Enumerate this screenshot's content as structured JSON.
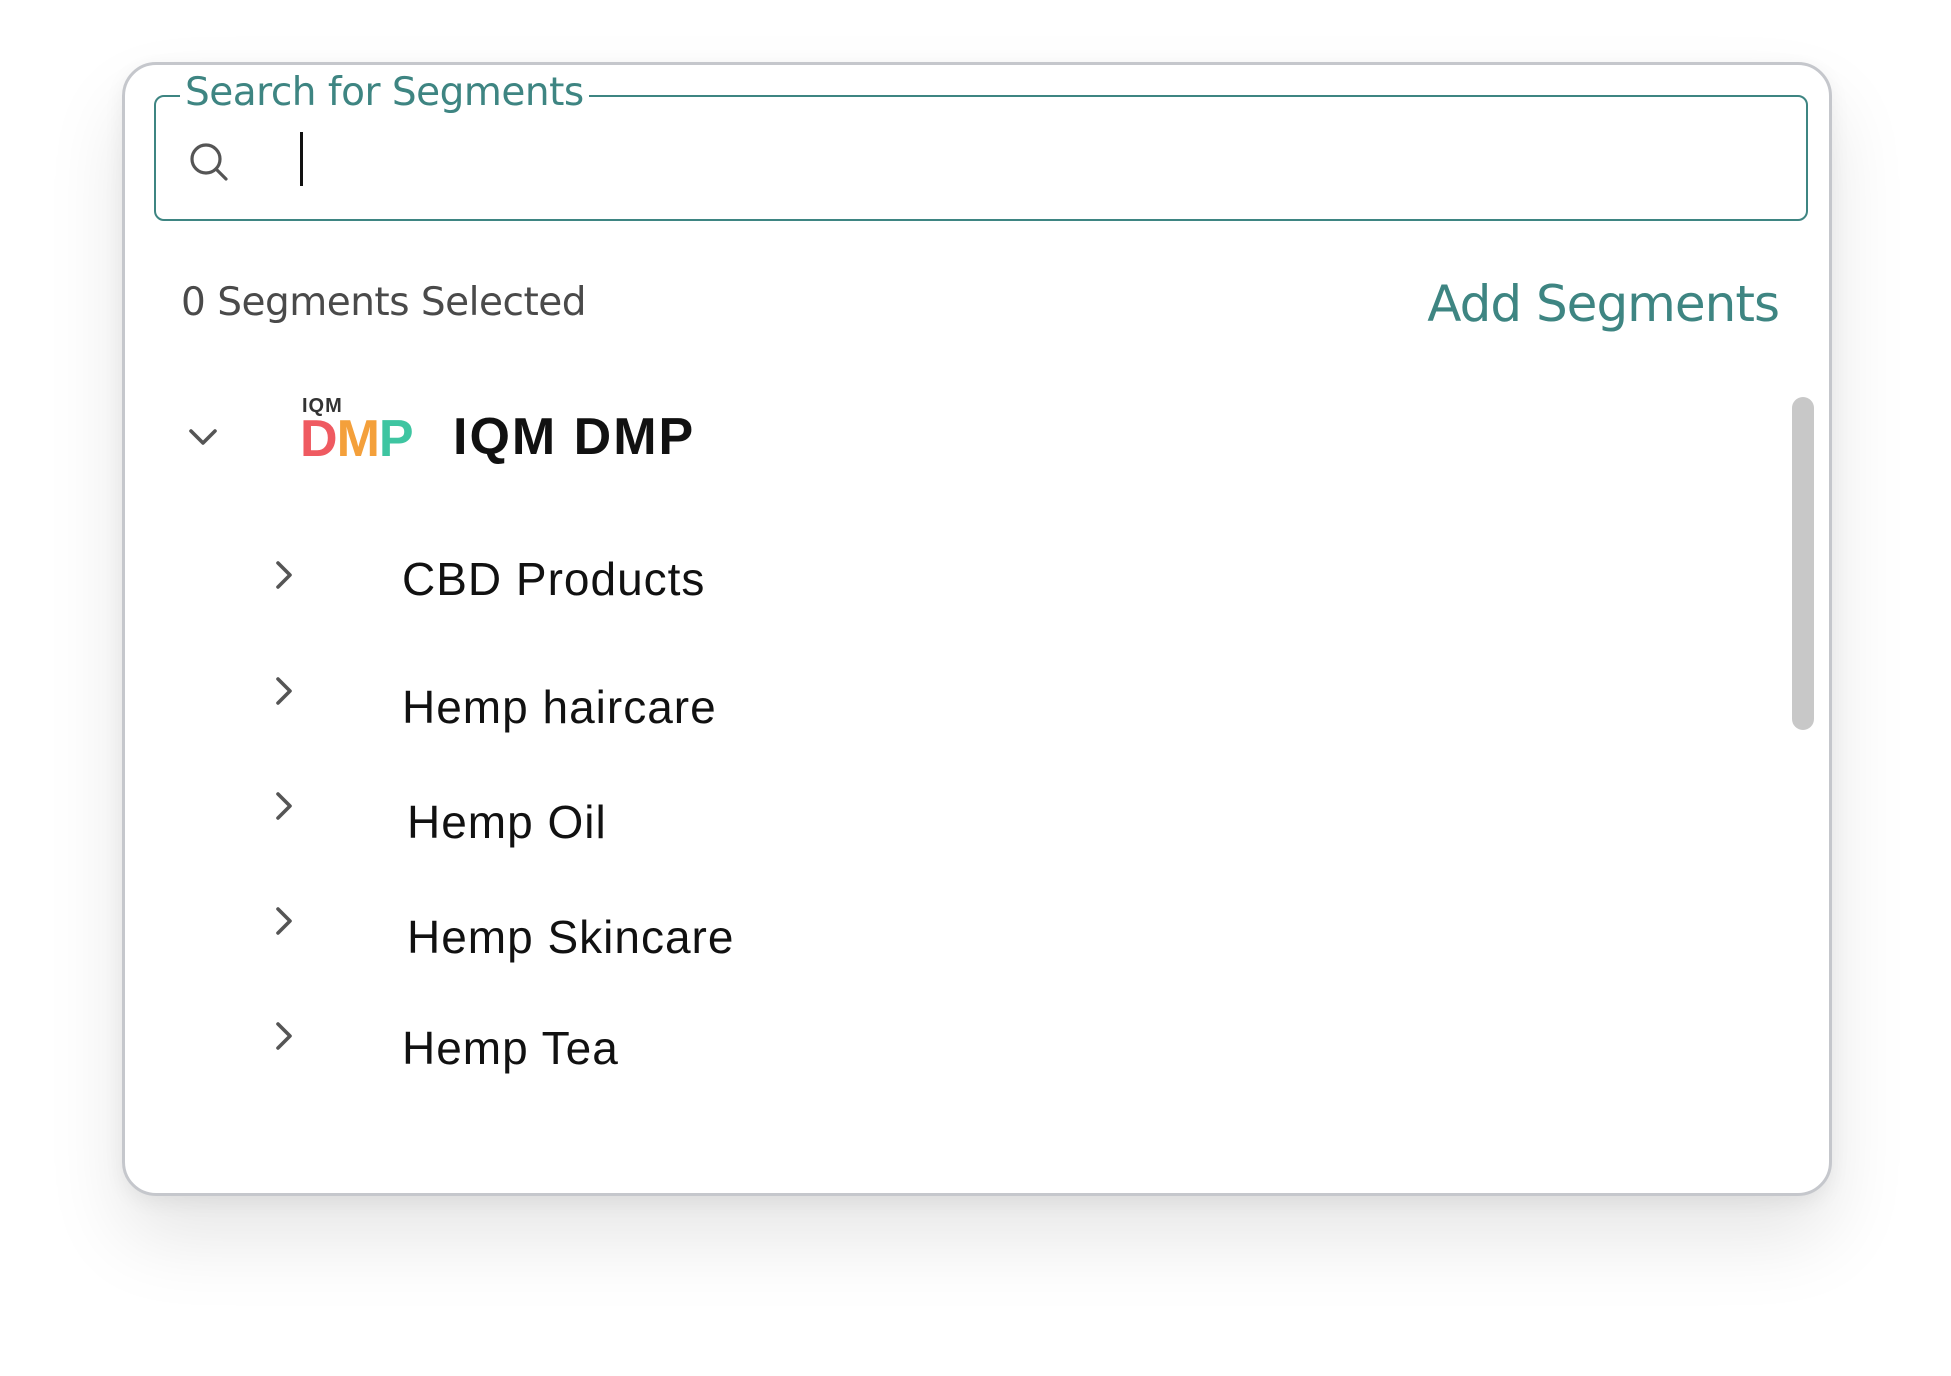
{
  "search": {
    "legend": "Search for Segments",
    "value": "",
    "placeholder": ""
  },
  "summary": {
    "selected_count_text": "0 Segments Selected",
    "add_segments_label": "Add Segments"
  },
  "provider": {
    "logo_top": "IQM",
    "logo_main": [
      "D",
      "M",
      "P"
    ],
    "name": "IQM DMP",
    "expanded": true
  },
  "segments": [
    {
      "label": "CBD Products"
    },
    {
      "label": "Hemp haircare"
    },
    {
      "label": "Hemp Oil"
    },
    {
      "label": "Hemp Skincare"
    },
    {
      "label": "Hemp Tea"
    }
  ],
  "colors": {
    "accent": "#3e8582",
    "logo_d": "#ef5a61",
    "logo_m": "#f4a03b",
    "logo_p": "#3ec5a1"
  },
  "icons": {
    "search": "search-icon",
    "collapse": "chevron-down-icon",
    "expand": "chevron-right-icon"
  }
}
